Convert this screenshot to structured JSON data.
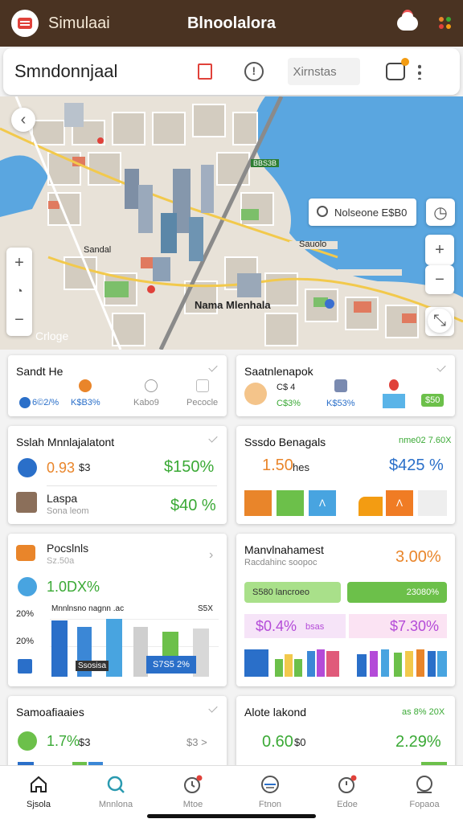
{
  "app": {
    "name": "Simulaai",
    "title": "Blnoolalora"
  },
  "search": {
    "title": "Smndonnjaal",
    "placeholder": "Xirnstas"
  },
  "map": {
    "search_text": "Nolseone E$B0",
    "labels": [
      "Sandal",
      "Nama Mlenhala",
      "Sauolo",
      "Crloge"
    ],
    "top_label": "BBS3B"
  },
  "cards": {
    "c1": {
      "title": "Sandt He",
      "items": [
        "6©2/%",
        "K$B3%",
        "Kabo9",
        "Pecocle"
      ]
    },
    "c2": {
      "title": "Saatnlenapok",
      "items": [
        "C$ 4",
        "C$3%",
        "K$53%",
        "$50"
      ]
    },
    "c3": {
      "title": "Sslah Mnnlajalatont",
      "row1_value": "0.93",
      "row1_suffix": "$3",
      "row1_pct": "$150%",
      "row2_title": "Laspa",
      "row2_sub": "Sona leom",
      "row2_pct": "$40 %"
    },
    "c4": {
      "title": "Sssdo Benagals",
      "header_pct": "nme02 7.60X",
      "left_value": "1.50",
      "left_suffix": "hes",
      "right_value": "$425 %"
    },
    "c5": {
      "title": "Pocslnls",
      "subtitle": "Sz.50a",
      "value": "1.0DX%",
      "chart_caption": "Mnnlnsno nagnn .ac",
      "y_labels": [
        "20%",
        "20%"
      ],
      "y_right": "S5X",
      "badge_dark": "Ssosisa",
      "badge_blue": "S7S5 2%"
    },
    "c6": {
      "title": "Manvlnahamest",
      "subtitle": "Racdahinc soopoc",
      "header_pct": "3.00%",
      "pill1_text": "S580 lancroeo",
      "pill1_pct": "23080%",
      "pill2_left": "$0.4%",
      "pill2_left_suffix": "bsas",
      "pill2_right": "$7.30%"
    },
    "c7": {
      "title": "Samoafiaaies",
      "value": "1.7%",
      "suffix": "$3",
      "right_value": "$3 >"
    },
    "c8": {
      "title": "Alote lakond",
      "header_pct": "as 8% 20X",
      "left_value": "0.60",
      "left_suffix": "$0",
      "right_value": "2.29%"
    }
  },
  "nav": [
    {
      "label": "Sjsola",
      "icon": "home-icon",
      "active": true
    },
    {
      "label": "Mnnlona",
      "icon": "search-icon",
      "active": false
    },
    {
      "label": "Mtoe",
      "icon": "clock-icon",
      "active": false
    },
    {
      "label": "Ftnon",
      "icon": "calendar-icon",
      "active": false
    },
    {
      "label": "Edoe",
      "icon": "alarm-icon",
      "active": false
    },
    {
      "label": "Fopaoa",
      "icon": "profile-icon",
      "active": false
    }
  ],
  "colors": {
    "topbar": "#4a3322",
    "green": "#3aa935",
    "blue": "#2a6fc9",
    "orange": "#e9852a",
    "water": "#5aa6e0"
  }
}
